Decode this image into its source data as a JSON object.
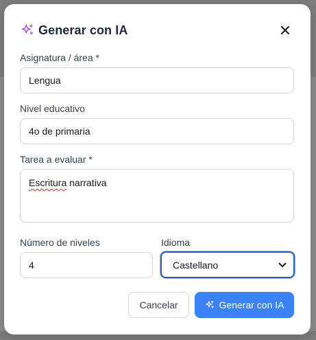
{
  "dialog": {
    "title": "Generar con IA",
    "icons": {
      "title": "sparkles-icon",
      "close": "close-icon",
      "button": "sparkles-icon"
    },
    "accent_color": "#a855f7"
  },
  "form": {
    "subject": {
      "label": "Asignatura / área *",
      "value": "Lengua"
    },
    "level": {
      "label": "Nivel educativo",
      "value": "4o de primaria"
    },
    "task": {
      "label": "Tarea a evaluar *",
      "value": "Escritura narrativa"
    },
    "num_levels": {
      "label": "Número de niveles",
      "value": "4"
    },
    "language": {
      "label": "Idioma",
      "selected": "Castellano"
    }
  },
  "actions": {
    "cancel_label": "Cancelar",
    "generate_label": "Generar con IA",
    "primary_color": "#3b82f6"
  }
}
